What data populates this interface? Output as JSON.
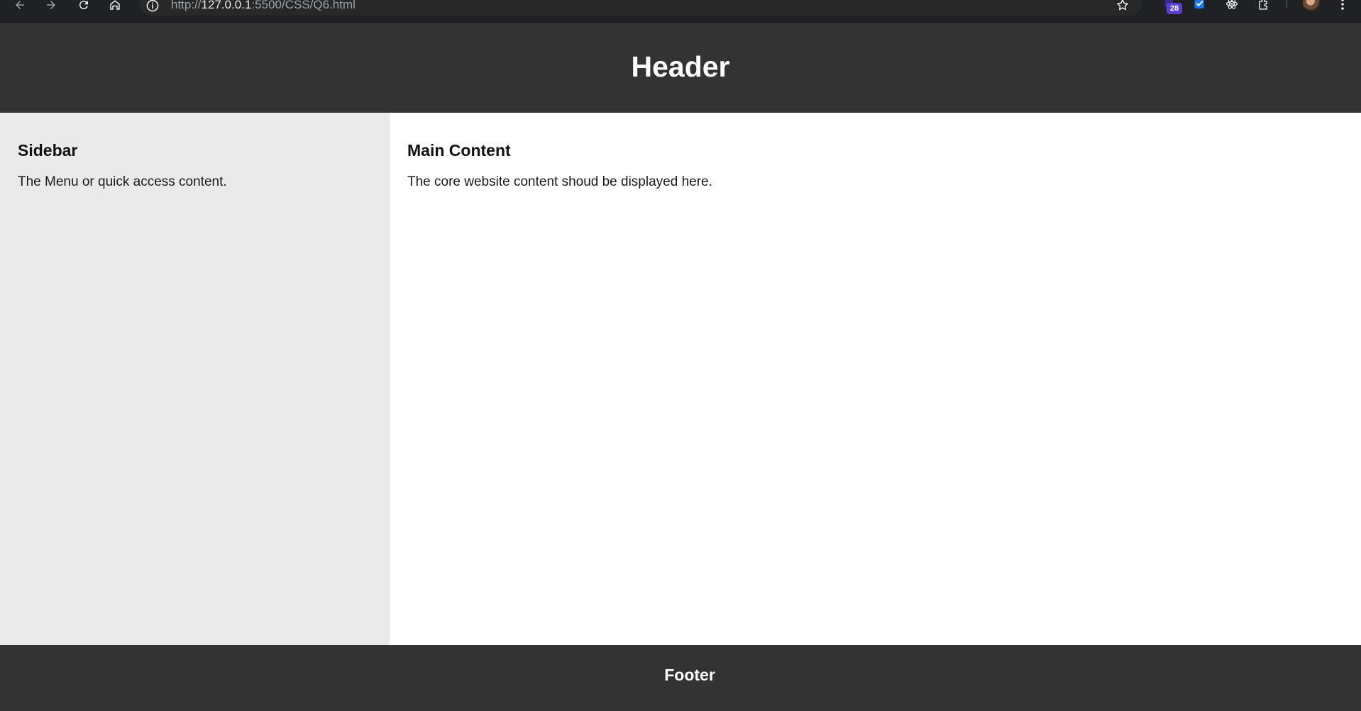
{
  "browser": {
    "url_prefix": "http://",
    "url_host": "127.0.0.1",
    "url_rest": ":5500/CSS/Q6.html",
    "extension_badge_count": "28",
    "icons": [
      "back-arrow-icon",
      "forward-arrow-icon",
      "reload-icon",
      "home-icon",
      "site-info-icon",
      "bookmark-star-icon",
      "extension-icon",
      "checkmark-extension-icon",
      "react-devtools-icon",
      "extensions-puzzle-icon",
      "profile-avatar",
      "kebab-menu-icon"
    ]
  },
  "page": {
    "header_title": "Header",
    "sidebar": {
      "title": "Sidebar",
      "text": "The Menu or quick access content."
    },
    "main": {
      "title": "Main Content",
      "text": "The core website content shoud be displayed here."
    },
    "footer_text": "Footer"
  },
  "colors": {
    "header_bg": "#333333",
    "sidebar_bg": "#eaeaea",
    "main_bg": "#ffffff",
    "footer_bg": "#333333",
    "badge": "#5b3fd0",
    "check_ext": "#1a73e8"
  }
}
